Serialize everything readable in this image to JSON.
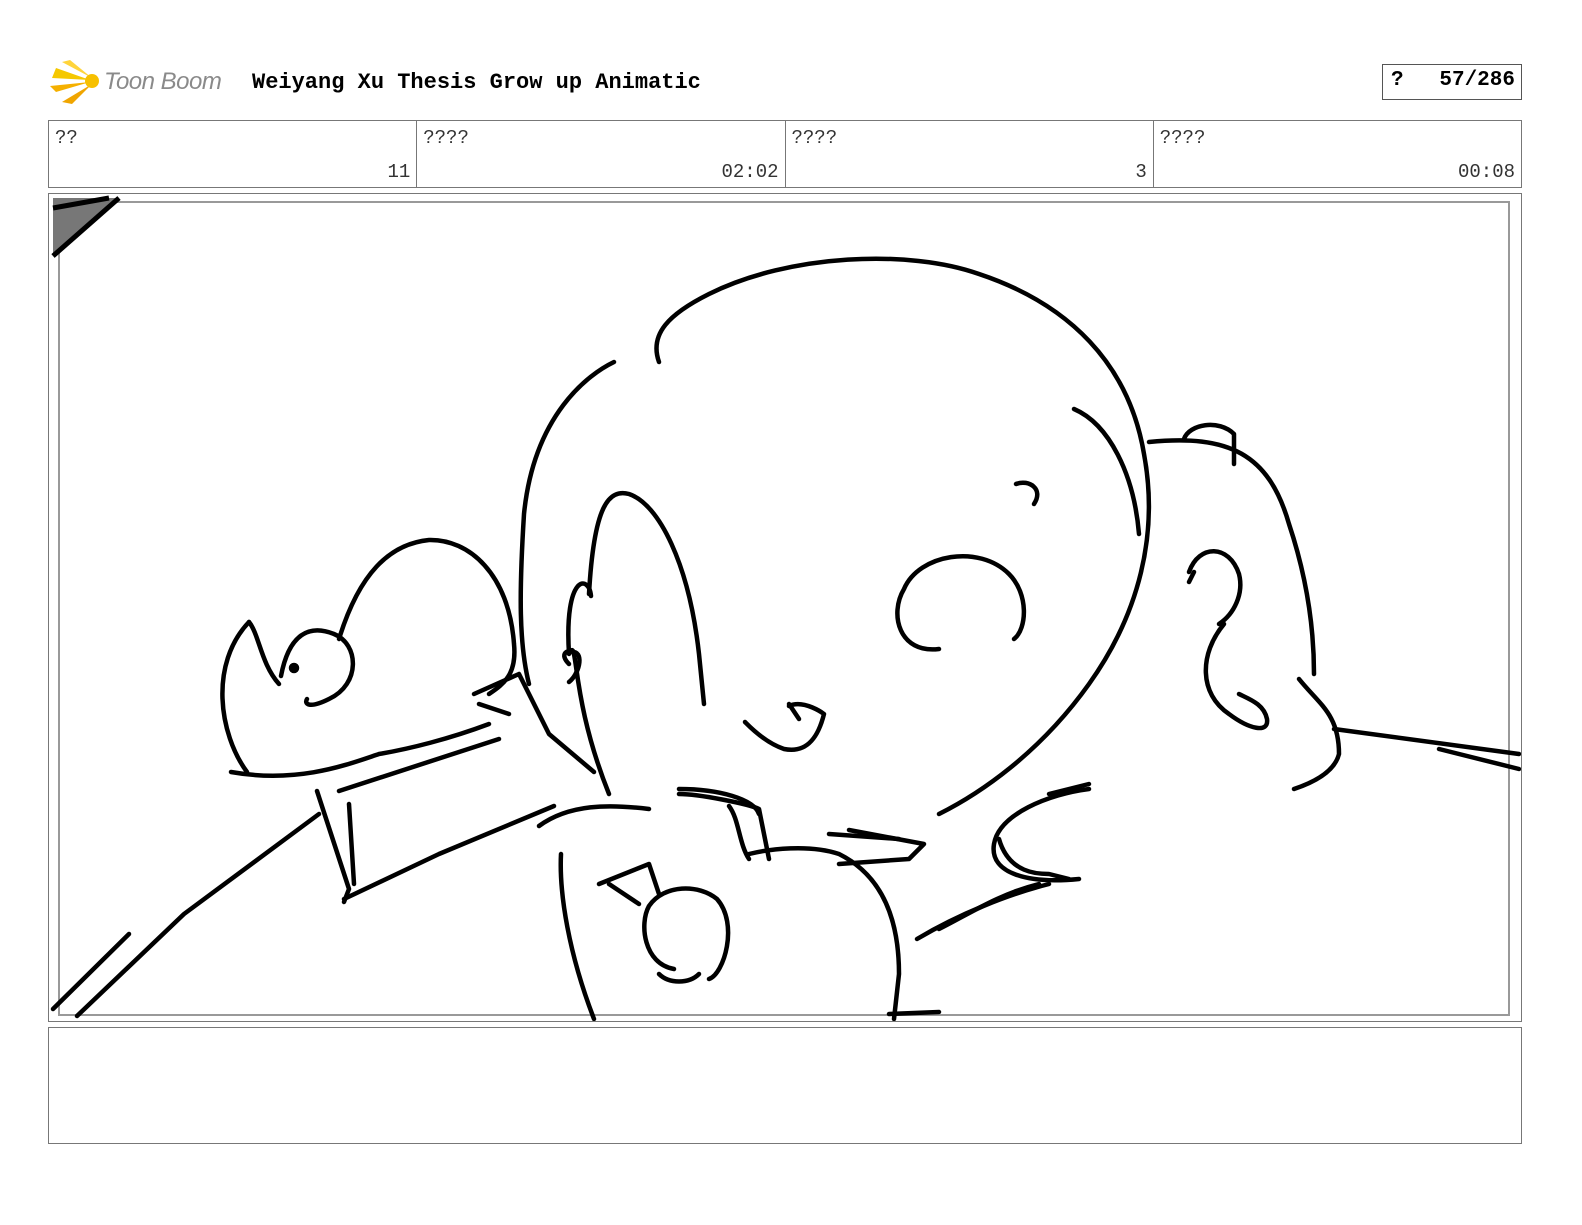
{
  "header": {
    "logo_text": "Toon Boom",
    "project_title": "Weiyang Xu Thesis Grow up Animatic",
    "page_prefix": "?",
    "page_number": "57/286"
  },
  "info_row": [
    {
      "label": "??",
      "value": "11"
    },
    {
      "label": "????",
      "value": "02:02"
    },
    {
      "label": "????",
      "value": "3"
    },
    {
      "label": "????",
      "value": "00:08"
    }
  ],
  "panel": {
    "image": "sketch-drawing"
  },
  "notes": {
    "text": ""
  }
}
